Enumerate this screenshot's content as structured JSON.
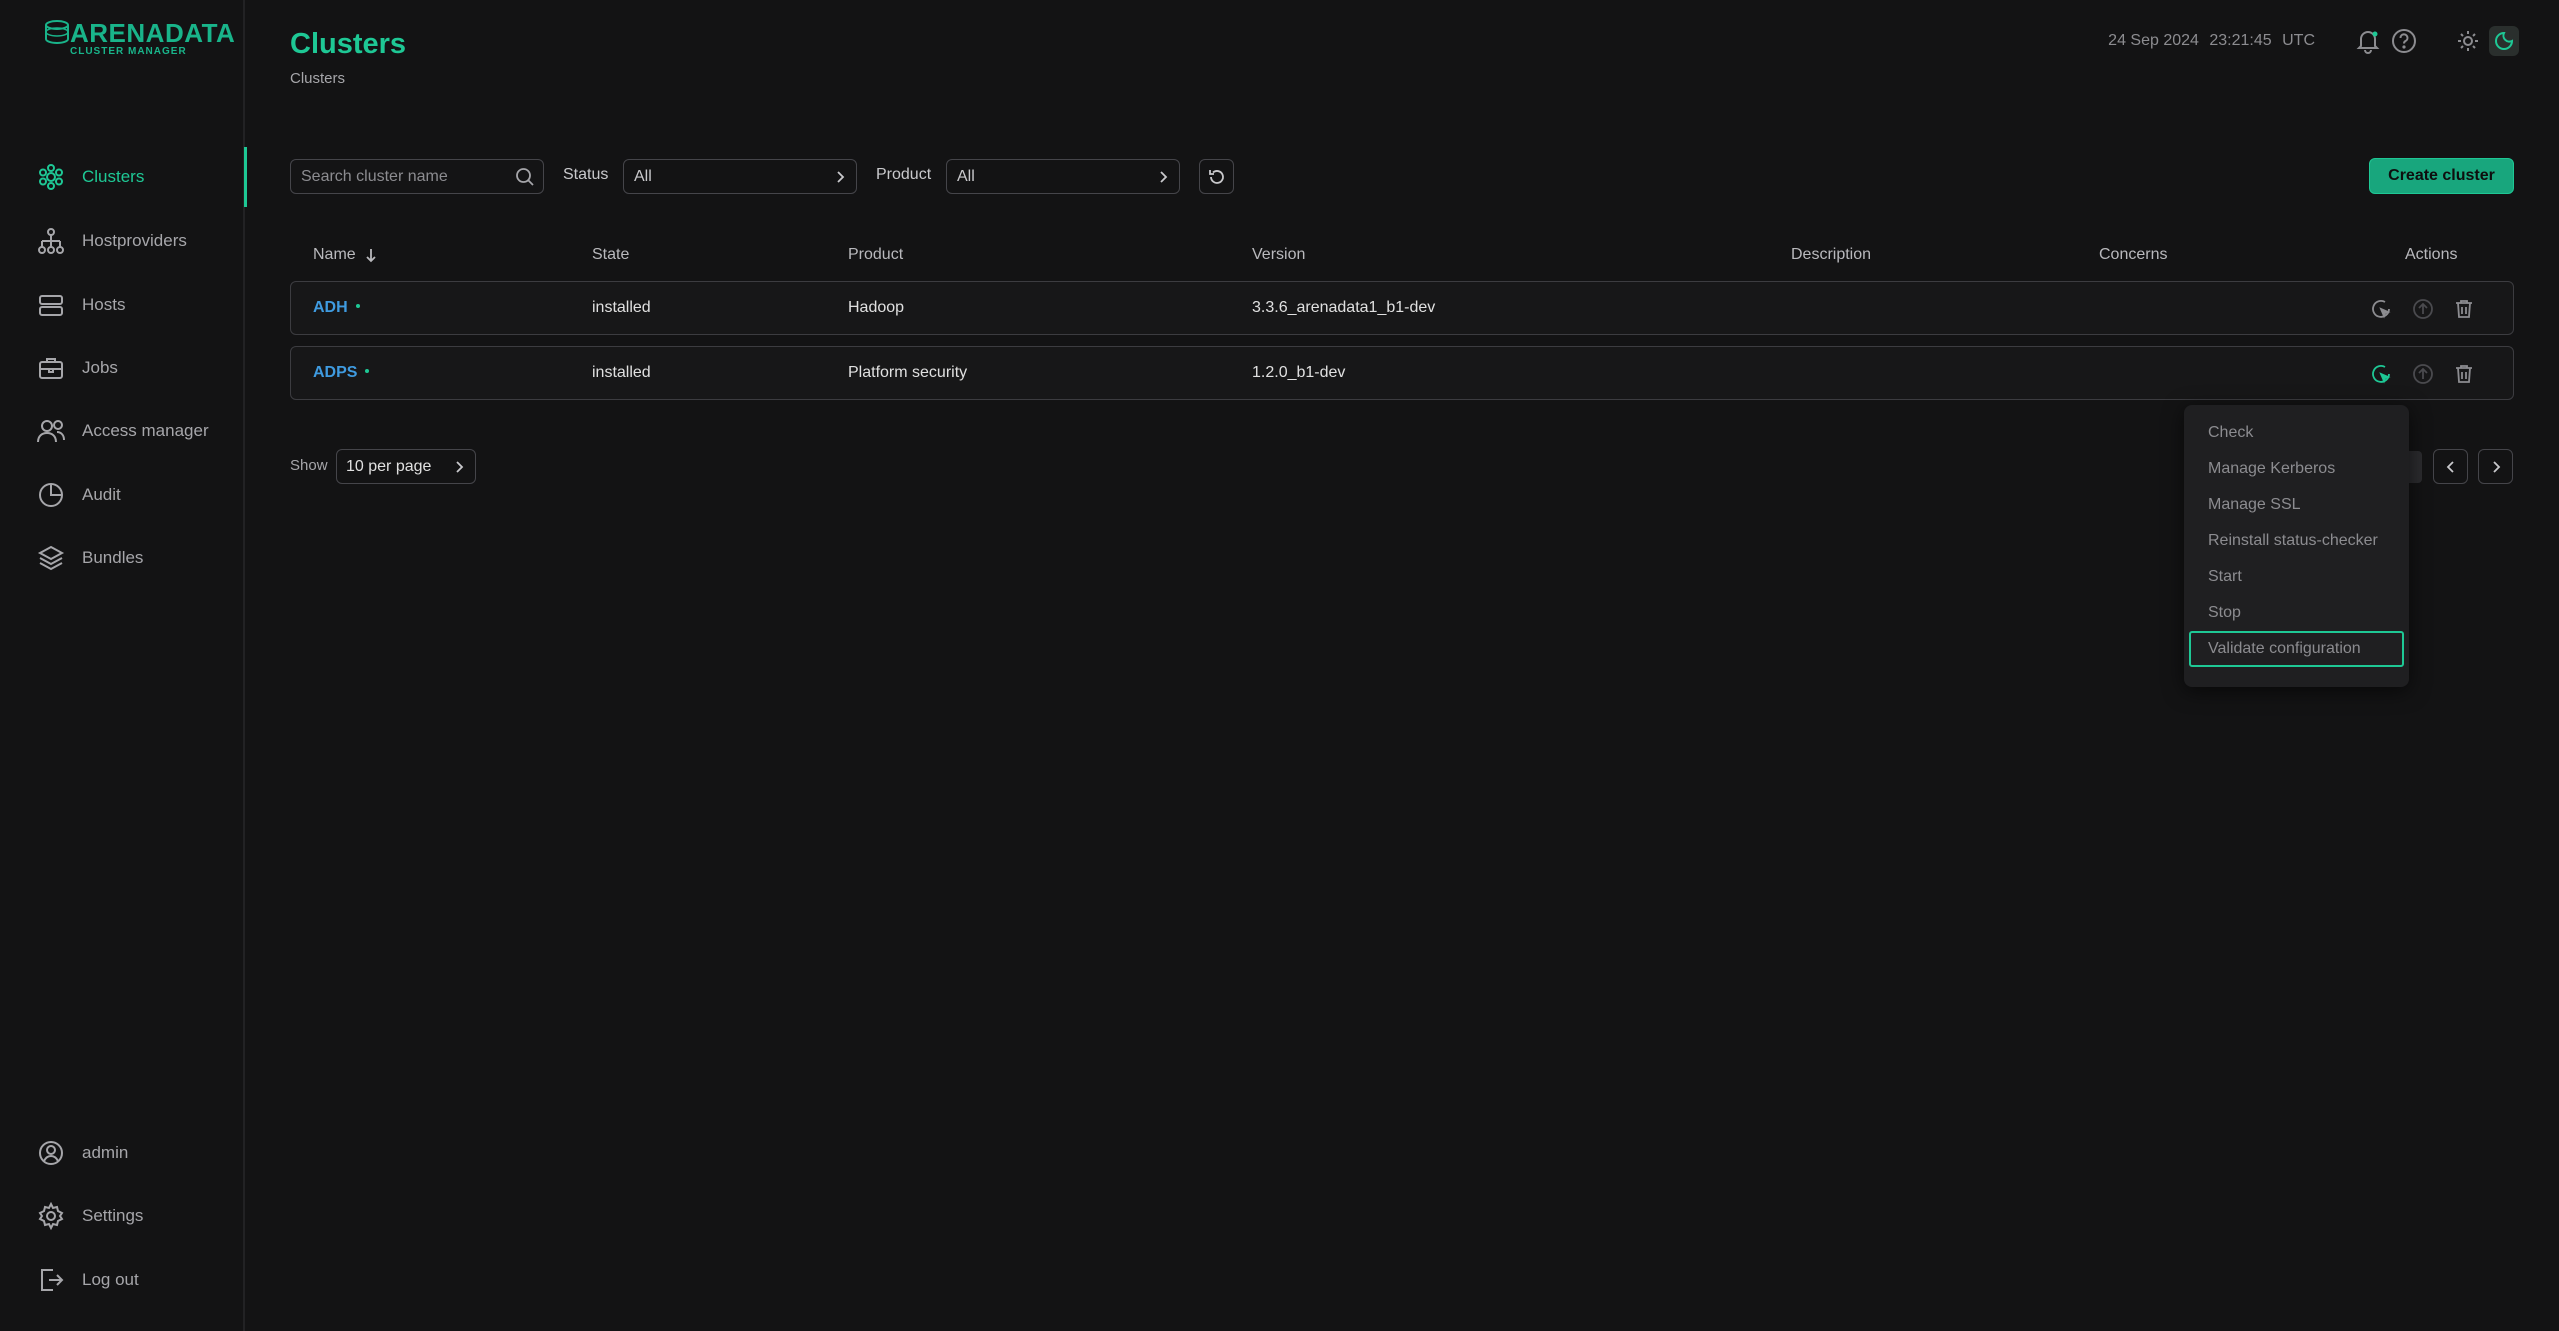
{
  "logo": {
    "main": "ARENADATA",
    "sub": "CLUSTER MANAGER"
  },
  "colors": {
    "accent": "#1ec895",
    "link": "#3f9be0",
    "background": "#131314"
  },
  "sidebar": {
    "items": [
      {
        "label": "Clusters",
        "icon": "clusters-icon",
        "active": true
      },
      {
        "label": "Hostproviders",
        "icon": "hostproviders-icon"
      },
      {
        "label": "Hosts",
        "icon": "hosts-icon"
      },
      {
        "label": "Jobs",
        "icon": "jobs-icon"
      },
      {
        "label": "Access manager",
        "icon": "access-manager-icon"
      },
      {
        "label": "Audit",
        "icon": "audit-icon"
      },
      {
        "label": "Bundles",
        "icon": "bundles-icon"
      }
    ],
    "bottom": [
      {
        "label": "admin",
        "icon": "user-icon"
      },
      {
        "label": "Settings",
        "icon": "gear-icon"
      },
      {
        "label": "Log out",
        "icon": "logout-icon"
      }
    ]
  },
  "header": {
    "title": "Clusters",
    "breadcrumb": "Clusters",
    "date": "24 Sep 2024",
    "time": "23:21:45",
    "timezone": "UTC"
  },
  "toolbar": {
    "search_placeholder": "Search cluster name",
    "status_label": "Status",
    "status_value": "All",
    "product_label": "Product",
    "product_value": "All",
    "create_label": "Create cluster"
  },
  "table": {
    "columns": {
      "name": "Name",
      "state": "State",
      "product": "Product",
      "version": "Version",
      "description": "Description",
      "concerns": "Concerns",
      "actions": "Actions"
    },
    "rows": [
      {
        "name": "ADH",
        "state": "installed",
        "product": "Hadoop",
        "version": "3.3.6_arenadata1_b1-dev",
        "description": "",
        "concerns": ""
      },
      {
        "name": "ADPS",
        "state": "installed",
        "product": "Platform security",
        "version": "1.2.0_b1-dev",
        "description": "",
        "concerns": ""
      }
    ]
  },
  "pagination": {
    "show_label": "Show",
    "per_page": "10 per page"
  },
  "actions_menu": {
    "items": [
      "Check",
      "Manage Kerberos",
      "Manage SSL",
      "Reinstall status-checker",
      "Start",
      "Stop",
      "Validate configuration"
    ],
    "focused": "Validate configuration"
  }
}
